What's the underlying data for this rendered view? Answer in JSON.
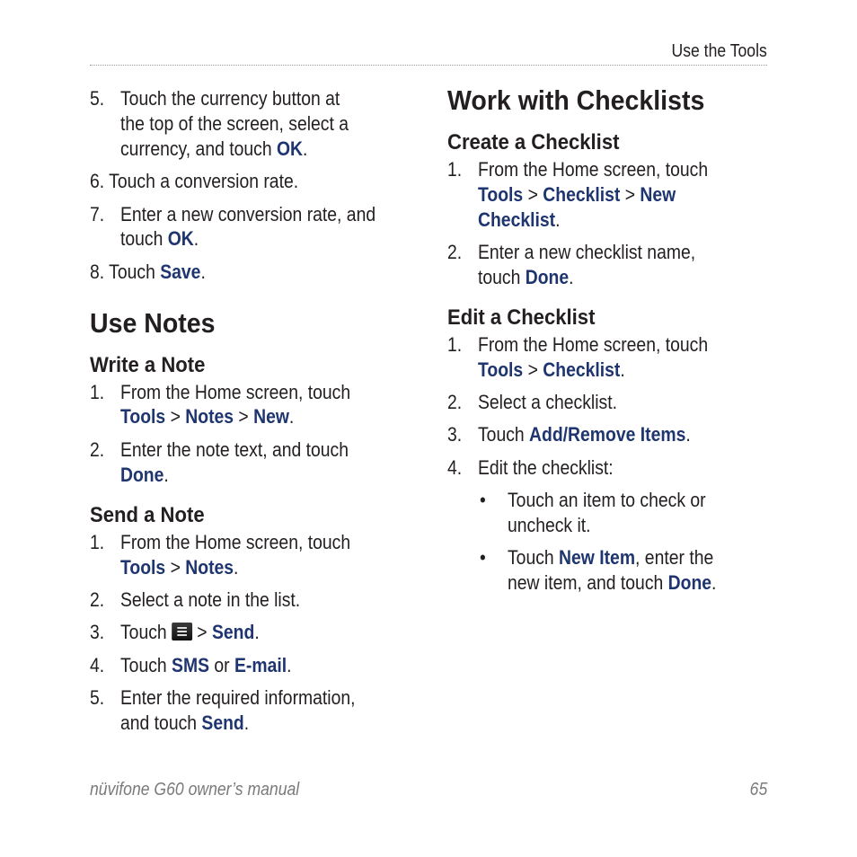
{
  "header": {
    "section_title": "Use the Tools"
  },
  "footer": {
    "manual_title": "nüvifone G60 owner’s manual",
    "page_number": "65"
  },
  "colors": {
    "accent": "#1f3570",
    "text": "#231f20",
    "footer": "#7a7a7a"
  },
  "left_column": {
    "currency_steps": {
      "s5_num": "5.",
      "s5_l1": "Touch the currency button at",
      "s5_l2": "the top of the screen, select a",
      "s5_l3a": "currency, and touch ",
      "s5_l3b": "OK",
      "s5_l3c": ".",
      "s6": "6. Touch a conversion rate.",
      "s7_num": "7.",
      "s7_l1": "Enter a new conversion rate, and",
      "s7_l2a": "touch ",
      "s7_l2b": "OK",
      "s7_l2c": ".",
      "s8a": "8. Touch ",
      "s8b": "Save",
      "s8c": "."
    },
    "notes": {
      "title": "Use Notes",
      "write": {
        "title": "Write a Note",
        "s1_num": "1.",
        "s1_l1": "From the Home screen, touch",
        "s1_tools": "Tools",
        "s1_notes": "Notes",
        "s1_new": "New",
        "s2_num": "2.",
        "s2_l1": "Enter the note text, and touch",
        "s2_done": "Done"
      },
      "send": {
        "title": "Send a Note",
        "s1_num": "1.",
        "s1_l1": "From the Home screen, touch",
        "s1_tools": "Tools",
        "s1_notes": "Notes",
        "s2_num": "2.",
        "s2_l1": "Select a note in the list.",
        "s3_num": "3.",
        "s3_touch": "Touch ",
        "s3_icon": "menu-icon",
        "s3_send": "Send",
        "s4_num": "4.",
        "s4_touch": "Touch ",
        "s4_sms": "SMS",
        "s4_or": " or ",
        "s4_email": "E-mail",
        "s5_num": "5.",
        "s5_l1": "Enter the required information,",
        "s5_l2a": "and touch ",
        "s5_send": "Send"
      }
    }
  },
  "right_column": {
    "title": "Work with Checklists",
    "create": {
      "title": "Create a Checklist",
      "s1_num": "1.",
      "s1_l1": "From the Home screen, touch",
      "s1_tools": "Tools",
      "s1_checklist": "Checklist",
      "s1_new": "New",
      "s1_checklist2": "Checklist",
      "s2_num": "2.",
      "s2_l1": "Enter a new checklist name,",
      "s2_touch": "touch ",
      "s2_done": "Done"
    },
    "edit": {
      "title": "Edit a Checklist",
      "s1_num": "1.",
      "s1_l1": "From the Home screen, touch",
      "s1_tools": "Tools",
      "s1_checklist": "Checklist",
      "s2_num": "2.",
      "s2_l1": "Select a checklist.",
      "s3_num": "3.",
      "s3_touch": "Touch ",
      "s3_items": "Add/Remove Items",
      "s4_num": "4.",
      "s4_l1": "Edit the checklist:",
      "bullet": "•",
      "b1_l1": "Touch an item to check or",
      "b1_l2": "uncheck it.",
      "b2_touch": "Touch ",
      "b2_new": "New Item",
      "b2_rest": ", enter the",
      "b2_l2": "new item, and touch ",
      "b2_done": "Done"
    }
  },
  "symbols": {
    "gt": " > ",
    "period": "."
  }
}
